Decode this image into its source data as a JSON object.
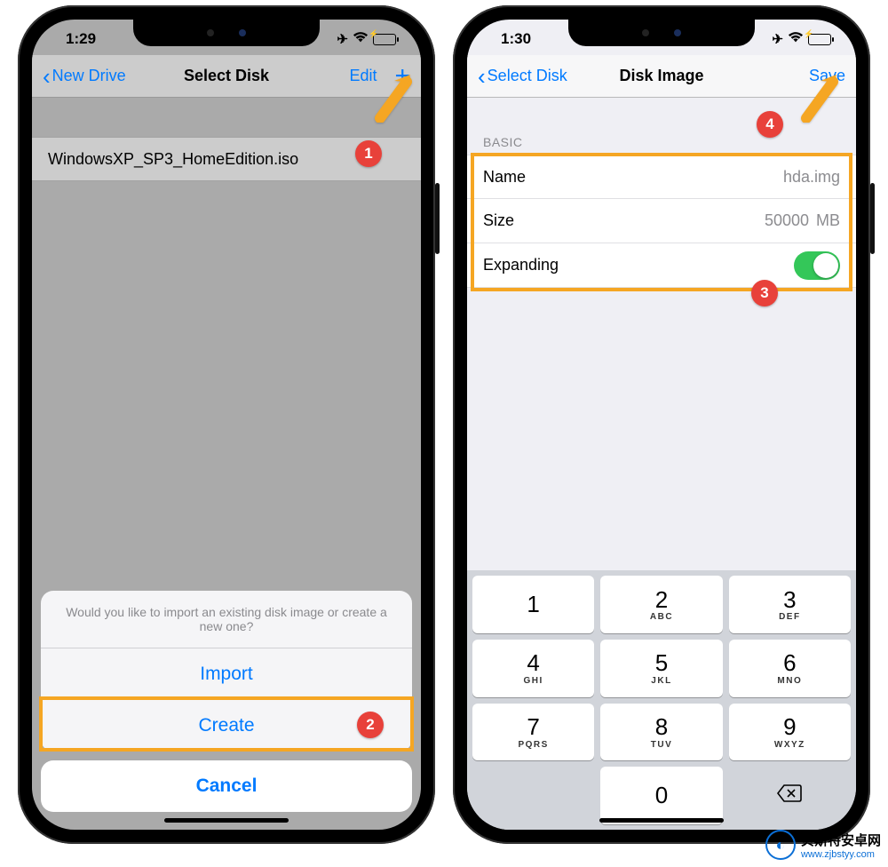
{
  "left": {
    "time": "1:29",
    "back_label": "New Drive",
    "title": "Select Disk",
    "edit_label": "Edit",
    "file_name": "WindowsXP_SP3_HomeEdition.iso",
    "sheet_message": "Would you like to import an existing disk image or create a new one?",
    "import_label": "Import",
    "create_label": "Create",
    "cancel_label": "Cancel"
  },
  "right": {
    "time": "1:30",
    "back_label": "Select Disk",
    "title": "Disk Image",
    "save_label": "Save",
    "section": "BASIC",
    "name_label": "Name",
    "name_value": "hda.img",
    "size_label": "Size",
    "size_value": "50000",
    "size_unit": "MB",
    "expanding_label": "Expanding",
    "keys": [
      {
        "n": "1",
        "s": ""
      },
      {
        "n": "2",
        "s": "ABC"
      },
      {
        "n": "3",
        "s": "DEF"
      },
      {
        "n": "4",
        "s": "GHI"
      },
      {
        "n": "5",
        "s": "JKL"
      },
      {
        "n": "6",
        "s": "MNO"
      },
      {
        "n": "7",
        "s": "PQRS"
      },
      {
        "n": "8",
        "s": "TUV"
      },
      {
        "n": "9",
        "s": "WXYZ"
      },
      {
        "n": "0",
        "s": ""
      }
    ]
  },
  "annotations": {
    "a1": "1",
    "a2": "2",
    "a3": "3",
    "a4": "4"
  },
  "watermark": {
    "line1": "贝斯特安卓网",
    "line2": "www.zjbstyy.com"
  }
}
